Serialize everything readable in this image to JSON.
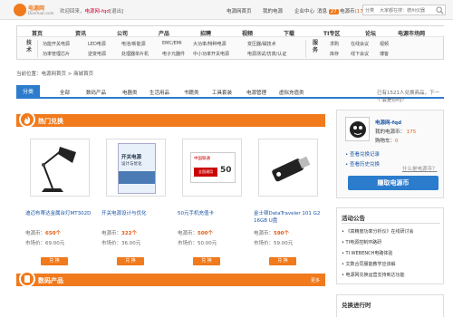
{
  "topbar": {
    "logo_text": "电源网",
    "logo_sub": "DianYuan.com",
    "welcome": "欢迎回来，",
    "user": "电源网-fqd",
    "logout": "[退出]",
    "links": [
      "电源网首页",
      "我的电源",
      "企业中心",
      "消息",
      "电源币"
    ],
    "message_count": "27",
    "coins": "(175)",
    "search_category": "分类",
    "search_placeholder": "大家都在搜：德州仪器"
  },
  "nav": {
    "top": [
      "首页",
      "资讯",
      "公司",
      "产品",
      "招聘",
      "视频",
      "下载",
      "TI专区",
      "论坛",
      "电源市场网"
    ],
    "tech_label": "技术",
    "service_label": "服务",
    "tech_row1": [
      "功能开关电源",
      "LED电源",
      "电池/新能源",
      "EMC/EMI",
      "大功率/特种电源",
      "变压器/磁技术"
    ],
    "tech_row2": [
      "功率管理芯片",
      "逆变电源",
      "处理器单片机",
      "电子元器件",
      "中小功率开关电源",
      "电源测试/仿真/认证"
    ],
    "service_row1": [
      "求购",
      "在线会议",
      "视频"
    ],
    "service_row2": [
      "库存",
      "线下会议",
      "博客"
    ]
  },
  "breadcrumb": "当前位置：电源网首页 > 商城首页",
  "tabs": {
    "active": "分类",
    "items": [
      "全部",
      "数码产品",
      "电器类",
      "生活用品",
      "书籍类",
      "工具套装",
      "电源管理",
      "虚拟充值类"
    ],
    "note": "已有1521人兑换商品，下一个会是你吗？"
  },
  "hot_section": {
    "title": "热门兑换",
    "cards": [
      {
        "title": "迪迈布蒂达金属台灯MT302D",
        "price_label": "电源币：",
        "price": "650个",
        "market_label": "市场价：",
        "market": "69.00元",
        "button": "兑 换"
      },
      {
        "title": "开关电源设计与优化",
        "price_label": "电源币：",
        "price": "322个",
        "market_label": "市场价：",
        "market": "36.00元",
        "button": "兑 换"
      },
      {
        "title": "50元手机充值卡",
        "price_label": "电源币：",
        "price": "500个",
        "market_label": "市场价：",
        "market": "50.00元",
        "button": "兑 换"
      },
      {
        "title": "金士顿DataTraveler 101 G2 16GB U盘",
        "price_label": "电源币：",
        "price": "590个",
        "market_label": "市场价：",
        "market": "59.00元",
        "button": "兑 换"
      }
    ]
  },
  "digital_section": {
    "title": "数码产品",
    "more": "更多"
  },
  "book_cover": {
    "title": "开关电源",
    "subtitle": "设计与优化"
  },
  "card_graphic": {
    "brand": "中国联通",
    "name": "全国通用",
    "value": "50"
  },
  "user_panel": {
    "name": "电源网-fqd",
    "coins_label": "我的电源币：",
    "coins": "175",
    "cart_label": "购物车：",
    "cart": "0",
    "link1": "查看兑换记录",
    "link2": "查看历史兑换",
    "rules_link": "什么是电源币？",
    "exchange_button": "赚取电源币"
  },
  "notice": {
    "title": "活动公告",
    "items": [
      "《高精度功率分析仪》在线研讨会",
      "TI电源控制环路研",
      "TI WEBENCH电路体验",
      "文数合同服能教学应该解",
      "电源网兑换运营支持到达功能"
    ]
  },
  "rank": {
    "title": "兑换进行时"
  },
  "colors": {
    "orange": "#f07a1c",
    "blue": "#2b7ccc",
    "link": "#1a55a6"
  }
}
